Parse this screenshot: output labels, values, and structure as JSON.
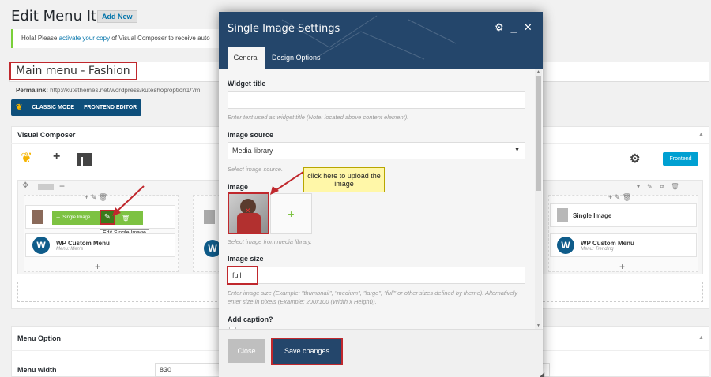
{
  "page": {
    "title": "Edit Menu Item",
    "add_new": "Add New",
    "notice_prefix": "Hola! Please ",
    "notice_link": "activate your copy",
    "notice_suffix": " of Visual Composer to receive auto",
    "post_title": "Main menu - Fashion",
    "permalink_label": "Permalink:",
    "permalink_url": "http://kutethemes.net/wordpress/kuteshop/option1/?m",
    "classic_mode": "CLASSIC MODE",
    "frontend_editor": "FRONTEND EDITOR"
  },
  "vc": {
    "header": "Visual Composer",
    "frontend_button": "Frontend",
    "collapse_icon": "triangle-up-icon"
  },
  "columns": {
    "left": {
      "single_image_label": "Single Image",
      "tooltip": "Edit Single Image",
      "menu_title": "WP Custom Menu",
      "menu_sub": "Menu: Men's"
    },
    "right": {
      "single_image_label": "Single Image",
      "menu_title": "WP Custom Menu",
      "menu_sub": "Menu: Trending"
    }
  },
  "menu_option": {
    "header": "Menu Option",
    "width_label": "Menu width",
    "width_value": "830"
  },
  "modal": {
    "title": "Single Image Settings",
    "tabs": [
      "General",
      "Design Options"
    ],
    "widget_title_label": "Widget title",
    "widget_title_help": "Enter text used as widget title (Note: located above content element).",
    "image_source_label": "Image source",
    "image_source_value": "Media library",
    "image_source_help": "Select image source.",
    "image_label": "Image",
    "image_help": "Select image from media library.",
    "image_size_label": "Image size",
    "image_size_value": "full",
    "image_size_help": "Enter image size (Example: \"thumbnail\", \"medium\", \"large\", \"full\" or other sizes defined by theme). Alternatively enter size in pixels (Example: 200x100 (Width x Height)).",
    "add_caption_label": "Add caption?",
    "close_button": "Close",
    "save_button": "Save changes",
    "callout_text": "click here to upload the image"
  }
}
